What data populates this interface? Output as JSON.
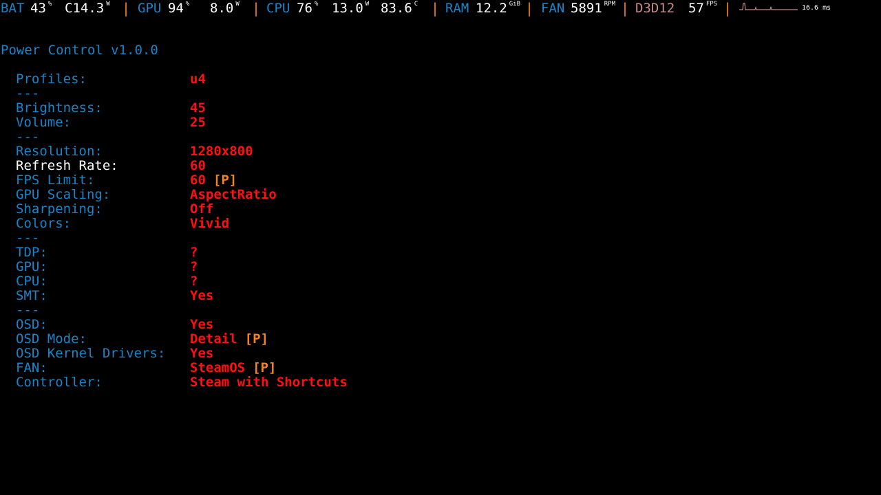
{
  "osd": {
    "bat": {
      "label": "BAT",
      "percent": "43",
      "percent_unit": "%",
      "power": "C14.3",
      "power_unit": "W"
    },
    "gpu": {
      "label": "GPU",
      "percent": "94",
      "percent_unit": "%",
      "power": "8.0",
      "power_unit": "W"
    },
    "cpu": {
      "label": "CPU",
      "percent": "76",
      "percent_unit": "%",
      "power": "13.0",
      "power_unit": "W",
      "temp": "83.6",
      "temp_unit": "C"
    },
    "ram": {
      "label": "RAM",
      "value": "12.2",
      "unit": "GiB"
    },
    "fan": {
      "label": "FAN",
      "value": "5891",
      "unit": "RPM"
    },
    "api": {
      "label": "D3D12",
      "fps": "57",
      "fps_unit": "FPS"
    },
    "frametime": {
      "value": "16.6 ms"
    },
    "separator": "|",
    "colors": {
      "label": "#1a84c8",
      "value": "#ffffff",
      "separator": "#f57f17",
      "api": "#c88a8a",
      "graph": "#c88a8a"
    }
  },
  "menu": {
    "title": "Power Control v1.0.0",
    "colors": {
      "key": "#1a84c8",
      "selected_key": "#ffffff",
      "value": "#ff1010",
      "profile_marker": "#f58220"
    },
    "rows": [
      {
        "key": "Profiles:",
        "value": "u4",
        "marker": ""
      },
      {
        "key": "---",
        "value": "",
        "marker": ""
      },
      {
        "key": "Brightness:",
        "value": "45",
        "marker": ""
      },
      {
        "key": "Volume:",
        "value": "25",
        "marker": ""
      },
      {
        "key": "---",
        "value": "",
        "marker": ""
      },
      {
        "key": "Resolution:",
        "value": "1280x800",
        "marker": ""
      },
      {
        "key": "Refresh Rate:",
        "value": "60",
        "marker": "",
        "selected": true
      },
      {
        "key": "FPS Limit:",
        "value": "60",
        "marker": "[P]"
      },
      {
        "key": "GPU Scaling:",
        "value": "AspectRatio",
        "marker": ""
      },
      {
        "key": "Sharpening:",
        "value": "Off",
        "marker": ""
      },
      {
        "key": "Colors:",
        "value": "Vivid",
        "marker": ""
      },
      {
        "key": "---",
        "value": "",
        "marker": ""
      },
      {
        "key": "TDP:",
        "value": "?",
        "marker": ""
      },
      {
        "key": "GPU:",
        "value": "?",
        "marker": ""
      },
      {
        "key": "CPU:",
        "value": "?",
        "marker": ""
      },
      {
        "key": "SMT:",
        "value": "Yes",
        "marker": ""
      },
      {
        "key": "---",
        "value": "",
        "marker": ""
      },
      {
        "key": "OSD:",
        "value": "Yes",
        "marker": ""
      },
      {
        "key": "OSD Mode:",
        "value": "Detail",
        "marker": "[P]"
      },
      {
        "key": "OSD Kernel Drivers:",
        "value": "Yes",
        "marker": ""
      },
      {
        "key": "FAN:",
        "value": "SteamOS",
        "marker": "[P]"
      },
      {
        "key": "Controller:",
        "value": "Steam with Shortcuts",
        "marker": ""
      }
    ]
  }
}
